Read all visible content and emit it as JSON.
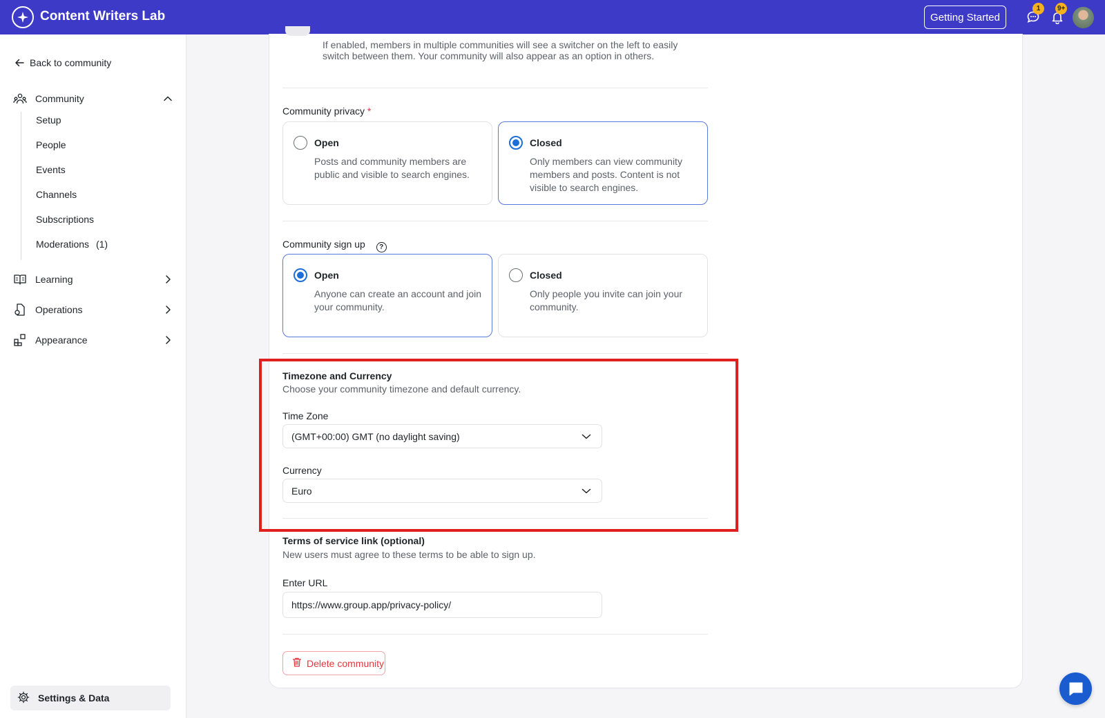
{
  "topbar": {
    "app_name": "Content Writers Lab",
    "getting_started_label": "Getting Started",
    "messages_badge": "1",
    "notifications_badge": "9+",
    "brand_color": "#3d3ac8",
    "icons": [
      "logo-star-icon",
      "chat-icon",
      "bell-icon",
      "avatar"
    ]
  },
  "sidebar": {
    "back_label": "Back to community",
    "community": {
      "label": "Community",
      "expanded": true,
      "items": [
        {
          "label": "Setup"
        },
        {
          "label": "People"
        },
        {
          "label": "Events"
        },
        {
          "label": "Channels"
        },
        {
          "label": "Subscriptions"
        },
        {
          "label": "Moderations",
          "count": "(1)"
        }
      ]
    },
    "sections": [
      {
        "label": "Learning",
        "icon": "book-icon"
      },
      {
        "label": "Operations",
        "icon": "operations-icon"
      },
      {
        "label": "Appearance",
        "icon": "grid-icon"
      }
    ],
    "settings_label": "Settings & Data"
  },
  "main": {
    "switcher_help": "If enabled, members in multiple communities will see a switcher on the left to easily switch between them. Your community will also appear as an option in others.",
    "privacy": {
      "label": "Community privacy",
      "required_mark": "*",
      "options": [
        {
          "title": "Open",
          "desc": "Posts and community members are public and visible to search engines.",
          "selected": false
        },
        {
          "title": "Closed",
          "desc": "Only members can view community members and posts. Content is not visible to search engines.",
          "selected": true
        }
      ]
    },
    "signup": {
      "label": "Community sign up",
      "help_glyph": "?",
      "options": [
        {
          "title": "Open",
          "desc": "Anyone can create an account and join your community.",
          "selected": true
        },
        {
          "title": "Closed",
          "desc": "Only people you invite can join your community.",
          "selected": false
        }
      ]
    },
    "timezone_currency": {
      "title": "Timezone and Currency",
      "subtitle": "Choose your community timezone and default currency.",
      "timezone_label": "Time Zone",
      "timezone_value": "(GMT+00:00) GMT (no daylight saving)",
      "currency_label": "Currency",
      "currency_value": "Euro",
      "highlight_color": "#e01f1f"
    },
    "terms": {
      "title": "Terms of service link (optional)",
      "subtitle": "New users must agree to these terms to be able to sign up.",
      "url_label": "Enter URL",
      "url_value": "https://www.group.app/privacy-policy/"
    },
    "delete_label": "Delete community"
  }
}
